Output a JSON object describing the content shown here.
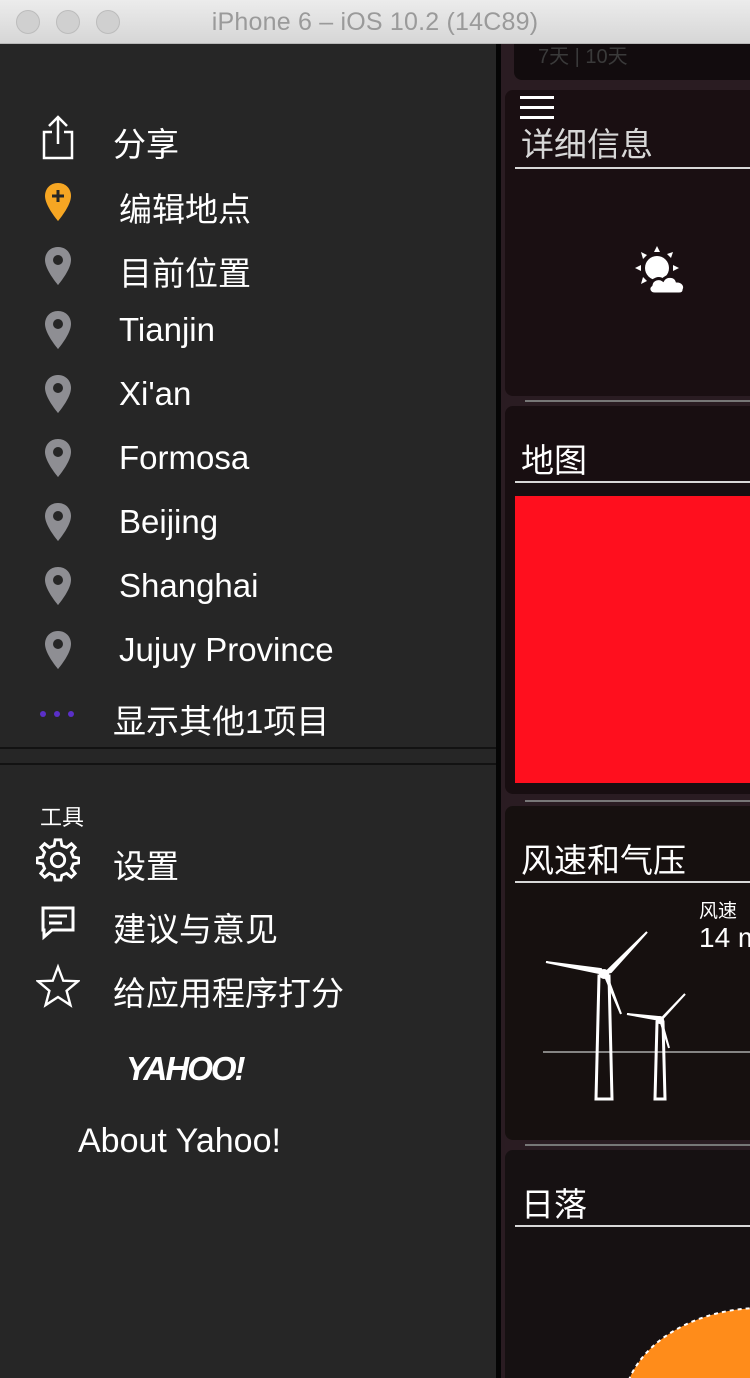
{
  "window": {
    "title": "iPhone 6 – iOS 10.2 (14C89)"
  },
  "sidebar": {
    "share_label": "分享",
    "edit_locations_label": "编辑地点",
    "locations": [
      {
        "label": "目前位置"
      },
      {
        "label": "Tianjin"
      },
      {
        "label": "Xi'an"
      },
      {
        "label": "Formosa"
      },
      {
        "label": "Beijing"
      },
      {
        "label": "Shanghai"
      },
      {
        "label": "Jujuy Province"
      }
    ],
    "show_more_label": "显示其他1项目",
    "tools_title": "工具",
    "settings_label": "设置",
    "feedback_label": "建议与意见",
    "rate_label": "给应用程序打分",
    "yahoo_logo_text": "YAHOO!",
    "about_label": "About Yahoo!"
  },
  "content": {
    "top_sliver_text": "7天 | 10天",
    "details_title": "详细信息",
    "map_title": "地图",
    "wind_title": "风速和气压",
    "wind_label": "风速",
    "wind_value": "14 m",
    "sunset_title": "日落",
    "weather_icon": "partly-sunny-icon"
  },
  "colors": {
    "sidebar_bg": "#262626",
    "edit_pin": "#f6a623",
    "location_pin": "#8e8e93",
    "more_dots": "#5a2fc8",
    "map_red": "#ff0f1e",
    "sun_orange": "#ff8c1a"
  }
}
